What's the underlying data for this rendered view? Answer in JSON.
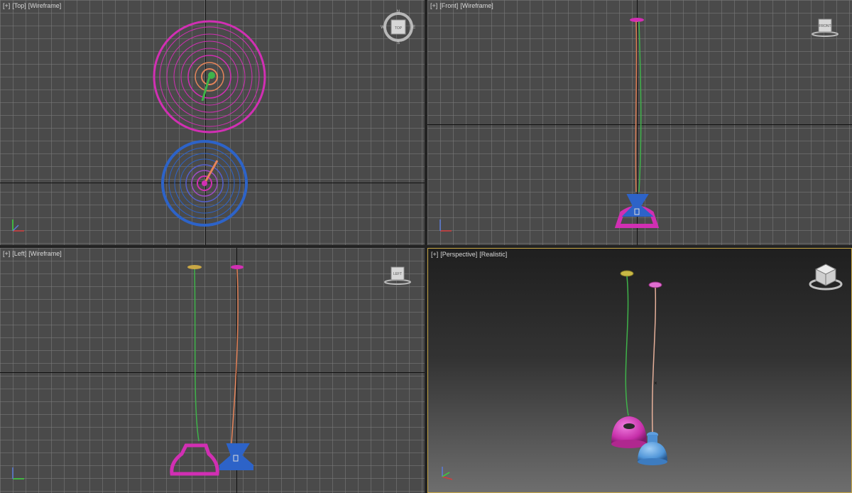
{
  "viewports": {
    "top": {
      "plus": "[+]",
      "name": "[Top]",
      "mode": "[Wireframe]",
      "compass": {
        "n": "N",
        "s": "S",
        "e": "E",
        "w": "W"
      },
      "cube_label": "TOP"
    },
    "front": {
      "plus": "[+]",
      "name": "[Front]",
      "mode": "[Wireframe]",
      "cube_label": "FRONT"
    },
    "left": {
      "plus": "[+]",
      "name": "[Left]",
      "mode": "[Wireframe]",
      "cube_label": "LEFT"
    },
    "perspective": {
      "plus": "[+]",
      "name": "[Perspective]",
      "mode": "[Realistic]",
      "active": true
    }
  },
  "colors": {
    "pink_lamp": "#d12fb3",
    "blue_lamp": "#2d63c8",
    "green_cord": "#3fb34a",
    "orange_cord": "#e6845a",
    "active_border": "#c9a845",
    "grid_bg": "#4a4a4a"
  },
  "icons": [
    "viewcube-icon",
    "compass-icon",
    "axis-tripod-icon"
  ]
}
